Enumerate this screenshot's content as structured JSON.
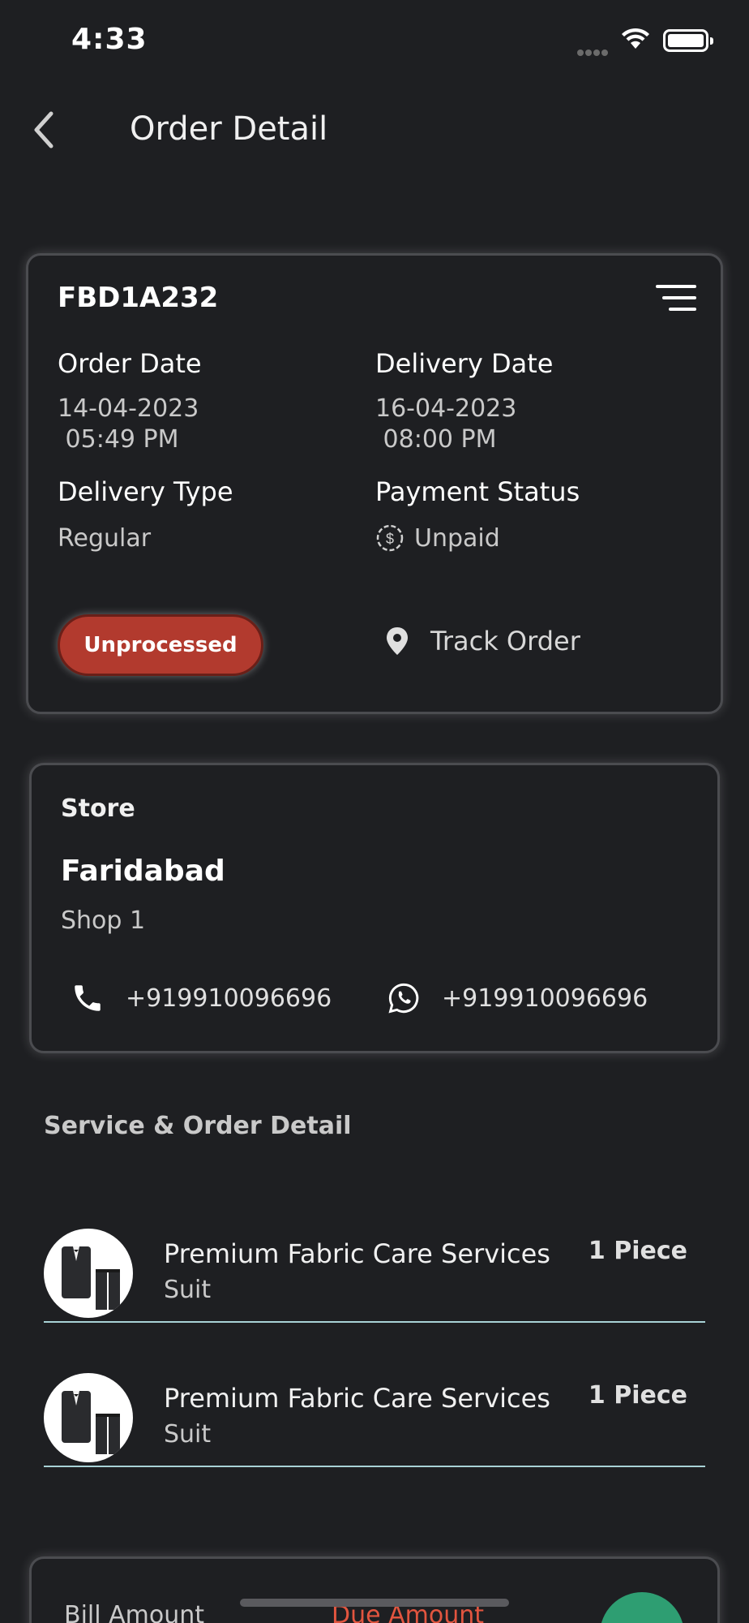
{
  "status_bar": {
    "time": "4:33"
  },
  "header": {
    "title": "Order Detail"
  },
  "order": {
    "id": "FBD1A232",
    "order_date_label": "Order Date",
    "order_date": "14-04-2023",
    "order_time": " 05:49 PM",
    "delivery_date_label": "Delivery Date",
    "delivery_date": "16-04-2023",
    "delivery_time": " 08:00 PM",
    "delivery_type_label": "Delivery Type",
    "delivery_type": "Regular",
    "payment_status_label": "Payment Status",
    "payment_status": "Unpaid",
    "status_badge": "Unprocessed",
    "track_label": "Track Order"
  },
  "store": {
    "label": "Store",
    "name": "Faridabad",
    "sub": "Shop 1",
    "phone": "+919910096696",
    "whatsapp": "+919910096696"
  },
  "services": {
    "title": "Service & Order Detail",
    "items": [
      {
        "name": "Premium Fabric Care Services",
        "item": "Suit",
        "qty": "1 Piece"
      },
      {
        "name": "Premium Fabric Care Services",
        "item": "Suit",
        "qty": "1 Piece"
      }
    ]
  },
  "bill": {
    "bill_amount_label": "Bill Amount",
    "due_amount_label": "Due Amount"
  },
  "colors": {
    "background": "#1e1f22",
    "status_badge": "#b23a2e",
    "due_amount": "#e2553f",
    "divider": "#a8d2d6",
    "fab": "#2e9e72"
  },
  "icons": [
    "back-arrow-icon",
    "menu-icon",
    "payment-clock-icon",
    "location-pin-icon",
    "phone-icon",
    "whatsapp-icon"
  ]
}
